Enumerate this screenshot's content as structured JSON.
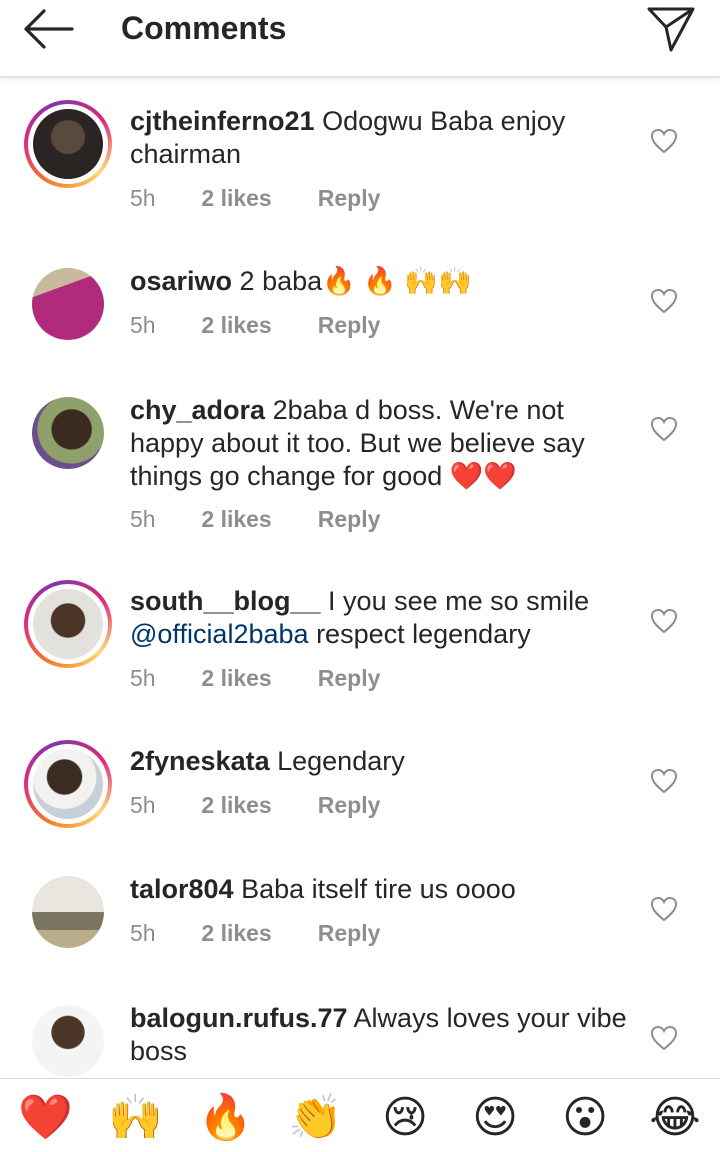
{
  "header": {
    "title": "Comments"
  },
  "comments": [
    {
      "username": "cjtheinferno21",
      "text": "Odogwu Baba enjoy chairman",
      "time": "5h",
      "likes": "2 likes",
      "reply": "Reply"
    },
    {
      "username": "osariwo",
      "text": "2 baba🔥 🔥 🙌🙌",
      "time": "5h",
      "likes": "2 likes",
      "reply": "Reply"
    },
    {
      "username": "chy_adora",
      "text": "2baba d boss. We're not happy about it too. But we believe say things go change for good ❤️❤️",
      "time": "5h",
      "likes": "2 likes",
      "reply": "Reply"
    },
    {
      "username": "south__blog__",
      "text": "I you see me so smile",
      "mention": "@official2baba",
      "text_after": "respect legendary",
      "time": "5h",
      "likes": "2 likes",
      "reply": "Reply"
    },
    {
      "username": "2fyneskata",
      "text": "Legendary",
      "time": "5h",
      "likes": "2 likes",
      "reply": "Reply"
    },
    {
      "username": "talor804",
      "text": "Baba itself tire us oooo",
      "time": "5h",
      "likes": "2 likes",
      "reply": "Reply"
    },
    {
      "username": "balogun.rufus.77",
      "text": "Always loves your vibe boss"
    }
  ],
  "emoji_bar": [
    "❤️",
    "🙌",
    "🔥",
    "👏",
    "😢",
    "😍",
    "😮",
    "😂"
  ],
  "colors": {
    "text": "#262626",
    "meta": "#8e8e8e",
    "mention": "#003569",
    "story_ring": "#dd2a7b"
  }
}
